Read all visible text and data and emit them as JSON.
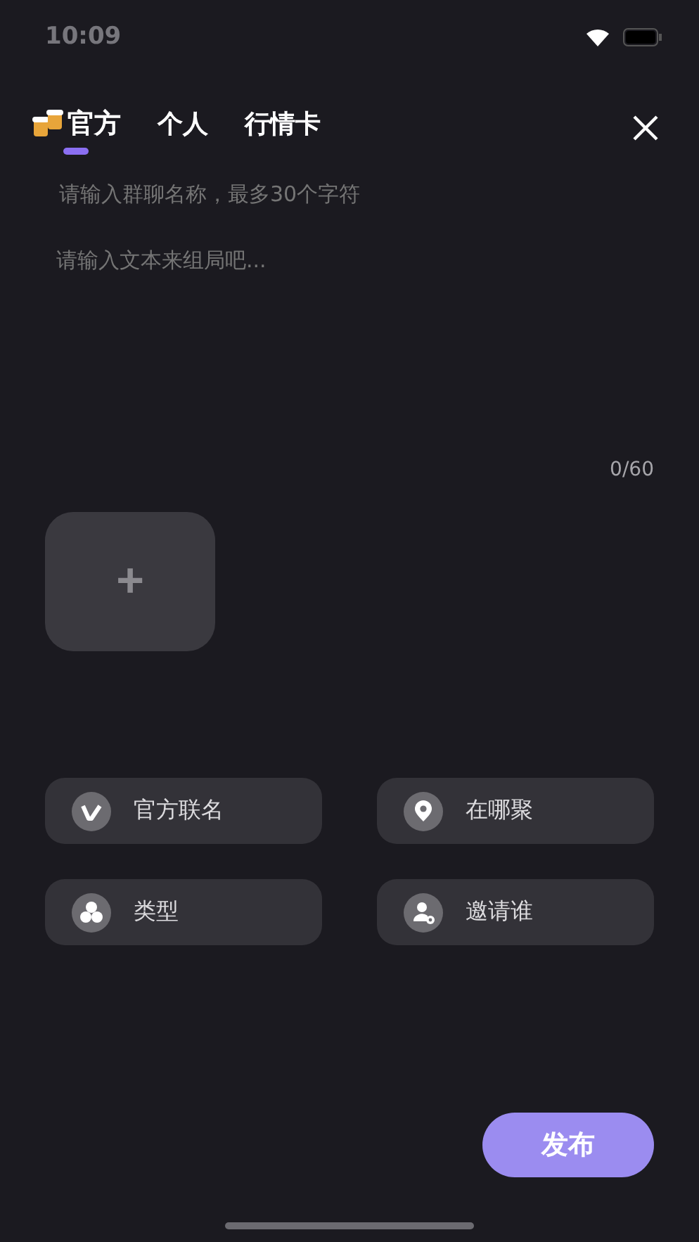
{
  "status_bar": {
    "time": "10:09"
  },
  "tabs": [
    {
      "label": "官方",
      "selected": true
    },
    {
      "label": "个人",
      "selected": false
    },
    {
      "label": "行情卡",
      "selected": false
    }
  ],
  "name_field": {
    "placeholder": "请输入群聊名称，最多30个字符"
  },
  "text_area": {
    "placeholder": "请输入文本来组局吧...",
    "counter": "0/60"
  },
  "add_image": {
    "label": "+"
  },
  "options": [
    {
      "kind": "letter",
      "label": "官方联名"
    },
    {
      "kind": "location",
      "label": "在哪聚"
    },
    {
      "kind": "group",
      "label": "类型"
    },
    {
      "kind": "person",
      "label": "邀请谁"
    }
  ],
  "publish_button": {
    "label": "发布"
  }
}
